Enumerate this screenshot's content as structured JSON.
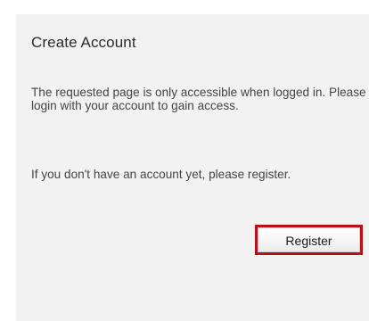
{
  "dialog": {
    "title": "Create Account",
    "message": "The requested page is only accessible when logged in. Please login with your account to gain access.",
    "register_prompt": "If you don't have an account yet, please register.",
    "register_label": "Register"
  },
  "colors": {
    "panel_background": "#f2f2f2",
    "button_highlight": "#b5121b"
  }
}
